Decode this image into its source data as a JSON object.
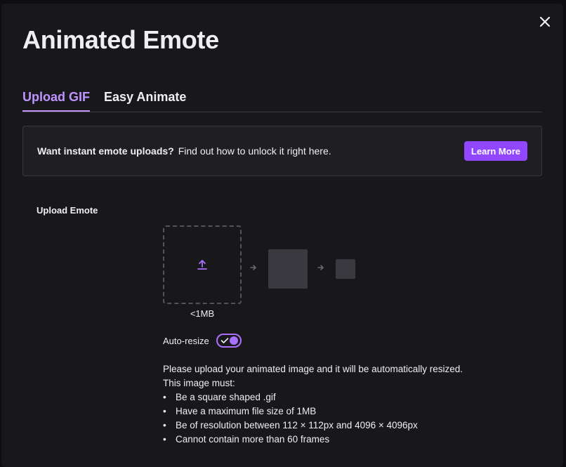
{
  "modal": {
    "title": "Animated Emote",
    "close_icon": "close-icon"
  },
  "tabs": [
    {
      "label": "Upload GIF",
      "active": true
    },
    {
      "label": "Easy Animate",
      "active": false
    }
  ],
  "banner": {
    "strong_text": "Want instant emote uploads?",
    "text": "Find out how to unlock it right here.",
    "button_label": "Learn More"
  },
  "upload": {
    "section_label": "Upload Emote",
    "upload_icon": "upload-icon",
    "size_caption": "<1MB",
    "arrow_icon": "arrow-right-icon",
    "auto_resize_label": "Auto-resize",
    "auto_resize_on": true,
    "description": "Please upload your animated image and it will be automatically resized.",
    "requirements_heading": "This image must:",
    "requirements": [
      "Be a square shaped .gif",
      "Have a maximum file size of 1MB",
      "Be of resolution between 112 × 112px and 4096 × 4096px",
      "Cannot contain more than 60 frames"
    ]
  },
  "colors": {
    "accent": "#9147ff",
    "accent_light": "#bf94ff",
    "background": "#18181b",
    "banner_bg": "#1f1f23",
    "preview_tile": "#3a393f"
  }
}
